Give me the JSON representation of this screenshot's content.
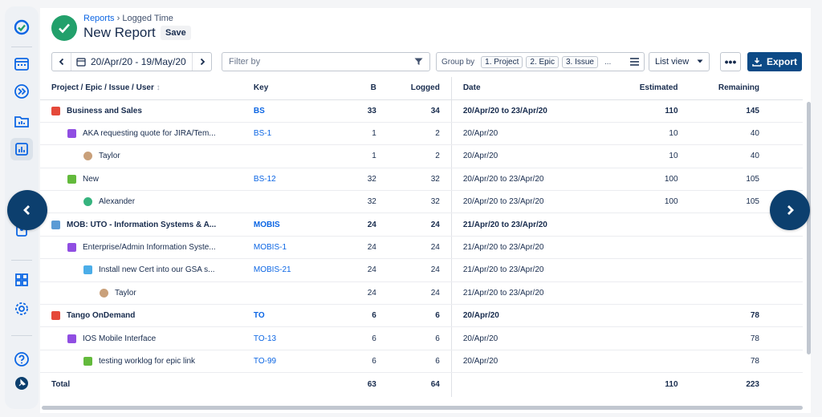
{
  "breadcrumb": {
    "parent": "Reports",
    "separator": "›",
    "current": "Logged Time"
  },
  "title": "New Report",
  "save_label": "Save",
  "date_range": "20/Apr/20 - 19/May/20",
  "filter_placeholder": "Filter by",
  "group_by": {
    "label": "Group by",
    "chips": [
      "1. Project",
      "2. Epic",
      "3. Issue"
    ],
    "ellipsis": "..."
  },
  "view_select": "List view",
  "more_label": "•••",
  "export_label": "Export",
  "columns": {
    "name": "Project / Epic / Issue / User",
    "key": "Key",
    "b": "B",
    "logged": "Logged",
    "date": "Date",
    "estimated": "Estimated",
    "remaining": "Remaining"
  },
  "rows": [
    {
      "name": "Business and Sales",
      "key": "BS",
      "b": "33",
      "logged": "34",
      "date": "20/Apr/20 to 23/Apr/20",
      "estimated": "110",
      "remaining": "145"
    },
    {
      "name": "AKA requesting quote for JIRA/Tem...",
      "key": "BS-1",
      "b": "1",
      "logged": "2",
      "date": "20/Apr/20",
      "estimated": "10",
      "remaining": "40"
    },
    {
      "name": "Taylor",
      "key": "",
      "b": "1",
      "logged": "2",
      "date": "20/Apr/20",
      "estimated": "10",
      "remaining": "40"
    },
    {
      "name": "New",
      "key": "BS-12",
      "b": "32",
      "logged": "32",
      "date": "20/Apr/20 to 23/Apr/20",
      "estimated": "100",
      "remaining": "105"
    },
    {
      "name": "Alexander",
      "key": "",
      "b": "32",
      "logged": "32",
      "date": "20/Apr/20 to 23/Apr/20",
      "estimated": "100",
      "remaining": "105"
    },
    {
      "name": "MOB: UTO - Information Systems & A...",
      "key": "MOBIS",
      "b": "24",
      "logged": "24",
      "date": "21/Apr/20 to 23/Apr/20",
      "estimated": "",
      "remaining": ""
    },
    {
      "name": "Enterprise/Admin Information Syste...",
      "key": "MOBIS-1",
      "b": "24",
      "logged": "24",
      "date": "21/Apr/20 to 23/Apr/20",
      "estimated": "",
      "remaining": ""
    },
    {
      "name": "Install new Cert into our GSA s...",
      "key": "MOBIS-21",
      "b": "24",
      "logged": "24",
      "date": "21/Apr/20 to 23/Apr/20",
      "estimated": "",
      "remaining": ""
    },
    {
      "name": "Taylor",
      "key": "",
      "b": "24",
      "logged": "24",
      "date": "21/Apr/20 to 23/Apr/20",
      "estimated": "",
      "remaining": ""
    },
    {
      "name": "Tango OnDemand",
      "key": "TO",
      "b": "6",
      "logged": "6",
      "date": "20/Apr/20",
      "estimated": "",
      "remaining": "78"
    },
    {
      "name": "IOS Mobile Interface",
      "key": "TO-13",
      "b": "6",
      "logged": "6",
      "date": "20/Apr/20",
      "estimated": "",
      "remaining": "78"
    },
    {
      "name": "testing worklog for epic link",
      "key": "TO-99",
      "b": "6",
      "logged": "6",
      "date": "20/Apr/20",
      "estimated": "",
      "remaining": "78"
    }
  ],
  "total": {
    "label": "Total",
    "b": "63",
    "logged": "64",
    "estimated": "110",
    "remaining": "223"
  },
  "colors": {
    "accent": "#0c4a86",
    "success": "#22a06b",
    "link": "#0c66e4"
  }
}
